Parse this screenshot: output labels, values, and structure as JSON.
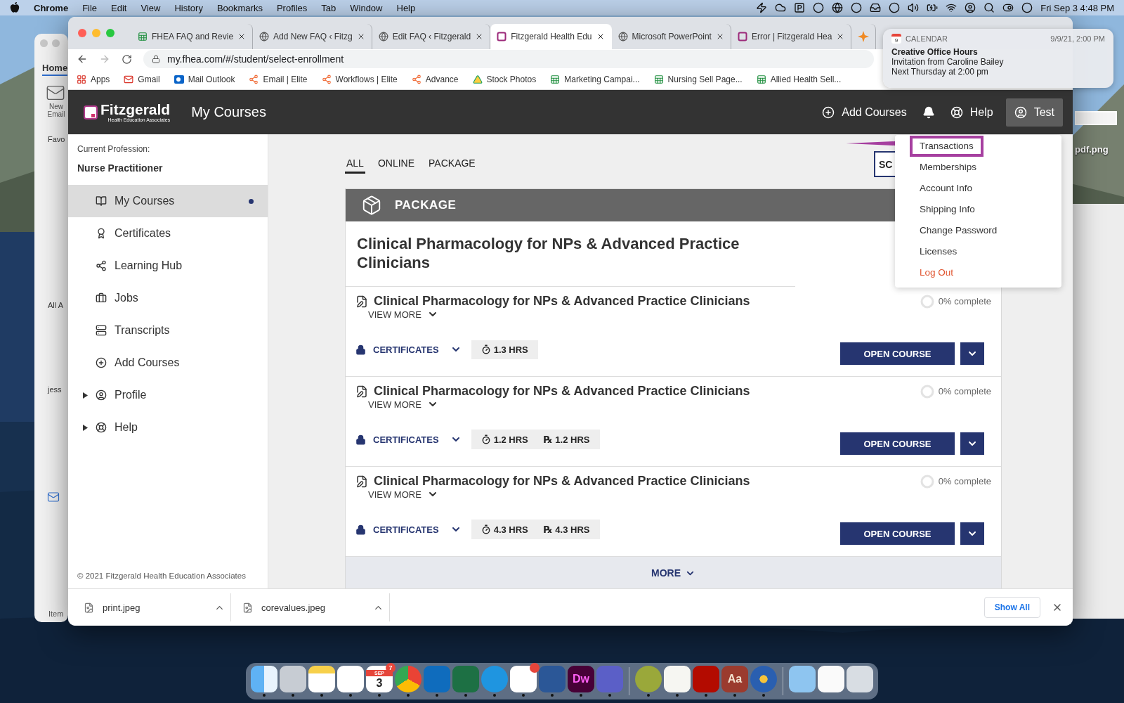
{
  "menu_bar": {
    "app": "Chrome",
    "menus": [
      "File",
      "Edit",
      "View",
      "History",
      "Bookmarks",
      "Profiles",
      "Tab",
      "Window",
      "Help"
    ],
    "clock": "Fri Sep 3  4:48 PM"
  },
  "mail_window": {
    "tab": "Home",
    "new_email": "New Email",
    "groups": [
      "Favo",
      "All A",
      "jess"
    ],
    "footer": "Item"
  },
  "browser": {
    "tabs": [
      {
        "title": "FHEA FAQ and Revie",
        "kind": "sheet",
        "selected": false
      },
      {
        "title": "Add New FAQ ‹ Fitzg",
        "kind": "globe",
        "selected": false
      },
      {
        "title": "Edit FAQ ‹ Fitzgerald",
        "kind": "globe",
        "selected": false
      },
      {
        "title": "Fitzgerald Health Edu",
        "kind": "brand",
        "selected": true
      },
      {
        "title": "Microsoft PowerPoint",
        "kind": "globe",
        "selected": false
      },
      {
        "title": "Error | Fitzgerald Hea",
        "kind": "brand",
        "selected": false
      },
      {
        "kind": "burst",
        "selected": false
      }
    ],
    "url": "my.fhea.com/#/student/select-enrollment",
    "bookmarks": [
      {
        "label": "Apps",
        "kind": "grid"
      },
      {
        "label": "Gmail",
        "kind": "mail"
      },
      {
        "label": "Mail Outlook",
        "kind": "outlook"
      },
      {
        "label": "Email | Elite",
        "kind": "hub"
      },
      {
        "label": "Workflows | Elite",
        "kind": "hub"
      },
      {
        "label": "Advance",
        "kind": "hub"
      },
      {
        "label": "Stock Photos",
        "kind": "drive"
      },
      {
        "label": "Marketing Campai...",
        "kind": "sheet"
      },
      {
        "label": "Nursing Sell Page...",
        "kind": "sheet"
      },
      {
        "label": "Allied Health Sell...",
        "kind": "sheet"
      }
    ]
  },
  "app": {
    "logo": {
      "name": "Fitzgerald",
      "tagline": "Health Education Associates"
    },
    "page_title": "My Courses",
    "header_actions": [
      {
        "kind": "add",
        "label": "Add Courses",
        "selected": false
      },
      {
        "kind": "bell",
        "selected": false
      },
      {
        "kind": "help",
        "label": "Help",
        "selected": false
      },
      {
        "kind": "user",
        "label": "Test",
        "selected": true
      }
    ],
    "sidebar": {
      "profession_label": "Current Profession:",
      "profession": "Nurse Practitioner",
      "items": [
        {
          "kind": "book",
          "label": "My Courses",
          "selected": true
        },
        {
          "kind": "certificate",
          "label": "Certificates",
          "selected": false
        },
        {
          "kind": "hub",
          "label": "Learning Hub",
          "selected": false
        },
        {
          "kind": "briefcase",
          "label": "Jobs",
          "selected": false
        },
        {
          "kind": "stack",
          "label": "Transcripts",
          "selected": false
        },
        {
          "kind": "plus",
          "label": "Add Courses",
          "selected": false
        },
        {
          "kind": "user",
          "label": "Profile",
          "selected": false,
          "expanded": false
        },
        {
          "kind": "help",
          "label": "Help",
          "selected": false,
          "expanded": false
        }
      ],
      "copyright": "© 2021 Fitzgerald Health Education Associates"
    },
    "filter_tabs": [
      {
        "label": "ALL",
        "selected": true
      },
      {
        "label": "ONLINE",
        "selected": false
      },
      {
        "label": "PACKAGE",
        "selected": false
      }
    ],
    "search_button": {
      "label": "SC"
    },
    "package": {
      "header": "PACKAGE",
      "title": "Clinical Pharmacology for NPs & Advanced Practice Clinicians",
      "courses": [
        {
          "title": "Clinical Pharmacology for NPs & Advanced Practice Clinicians",
          "view_more": "VIEW MORE",
          "certificates": "CERTIFICATES",
          "hours": [
            {
              "kind": "time",
              "label": "1.3 HRS"
            }
          ],
          "progress": "0% complete",
          "open": "OPEN COURSE"
        },
        {
          "title": "Clinical Pharmacology for NPs & Advanced Practice Clinicians",
          "view_more": "VIEW MORE",
          "certificates": "CERTIFICATES",
          "hours": [
            {
              "kind": "time",
              "label": "1.2 HRS"
            },
            {
              "kind": "rx",
              "symbol": "℞",
              "label": "1.2 HRS"
            }
          ],
          "progress": "0% complete",
          "open": "OPEN COURSE"
        },
        {
          "title": "Clinical Pharmacology for NPs & Advanced Practice Clinicians",
          "view_more": "VIEW MORE",
          "certificates": "CERTIFICATES",
          "hours": [
            {
              "kind": "time",
              "label": "4.3 HRS"
            },
            {
              "kind": "rx",
              "symbol": "℞",
              "label": "4.3 HRS"
            }
          ],
          "progress": "0% complete",
          "open": "OPEN COURSE"
        }
      ],
      "more": "MORE"
    },
    "user_menu": {
      "items": [
        {
          "kind": "link",
          "label": "Transactions",
          "highlighted": true
        },
        {
          "kind": "link",
          "label": "Memberships",
          "highlighted": false
        },
        {
          "kind": "link",
          "label": "Account Info",
          "highlighted": false
        },
        {
          "kind": "link",
          "label": "Shipping Info",
          "highlighted": false
        },
        {
          "kind": "link",
          "label": "Change Password",
          "highlighted": false
        },
        {
          "kind": "link",
          "label": "Licenses",
          "highlighted": false
        },
        {
          "kind": "danger",
          "label": "Log Out",
          "highlighted": false
        }
      ]
    }
  },
  "downloads": {
    "files": [
      "print.jpeg",
      "corevalues.jpeg"
    ],
    "show_all": "Show All"
  },
  "notification": {
    "icon_day": "9",
    "app": "CALENDAR",
    "time": "9/9/21, 2:00 PM",
    "title": "Creative Office Hours",
    "lines": [
      "Invitation from Caroline Bailey",
      "Next Thursday at 2:00 pm"
    ]
  },
  "desktop": {
    "file_label": "pdf.png"
  },
  "dock": {
    "sections": [
      [
        {
          "kind": "finder",
          "running": true,
          "alert": false
        },
        {
          "kind": "launchpad",
          "running": true,
          "alert": false
        },
        {
          "kind": "notes",
          "running": true,
          "alert": false
        },
        {
          "kind": "reminders",
          "running": true,
          "alert": false
        },
        {
          "kind": "calendar",
          "month": "SEP",
          "label": "3",
          "badge": "7",
          "running": true,
          "alert": false
        },
        {
          "kind": "chrome",
          "running": true,
          "alert": false
        },
        {
          "kind": "outlook",
          "running": true,
          "alert": false
        },
        {
          "kind": "excel",
          "running": true,
          "alert": false
        },
        {
          "kind": "skype",
          "running": true,
          "alert": false
        },
        {
          "kind": "slack",
          "running": true,
          "alert": true
        },
        {
          "kind": "word",
          "running": true,
          "alert": false
        },
        {
          "kind": "dreamweaver",
          "label": "Dw",
          "running": true,
          "alert": false
        },
        {
          "kind": "teams",
          "running": true,
          "alert": false
        }
      ],
      [
        {
          "kind": "wunder",
          "running": true,
          "alert": false
        },
        {
          "kind": "textedit",
          "running": true,
          "alert": false
        },
        {
          "kind": "acrobat",
          "running": true,
          "alert": false
        },
        {
          "kind": "dictionary",
          "label": "Aa",
          "running": true,
          "alert": false
        },
        {
          "kind": "bolt",
          "running": true,
          "alert": false
        }
      ],
      [
        {
          "kind": "folder",
          "running": false,
          "alert": false
        },
        {
          "kind": "document",
          "running": false,
          "alert": false
        },
        {
          "kind": "trash",
          "running": false,
          "alert": false
        }
      ]
    ]
  }
}
